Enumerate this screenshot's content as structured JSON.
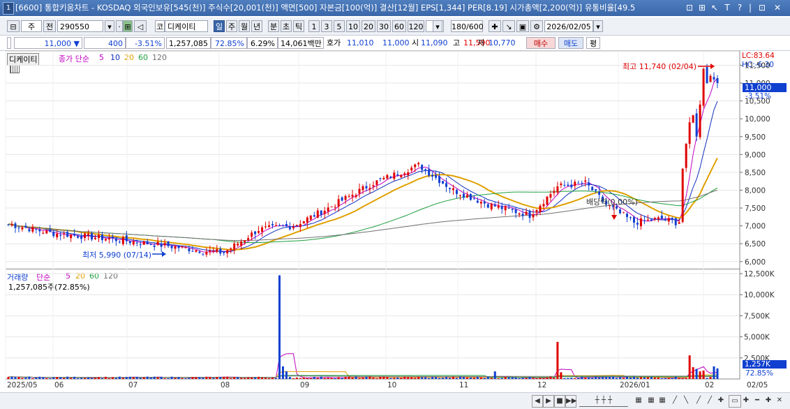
{
  "window": {
    "number": "1",
    "title": "[6600] 통합키움차트 - KOSDAQ 외국인보유[545(천)] 주식수[20,001(천)] 액면[500] 자본금[100(억)] 결산[12월] EPS[1,344] PER[8.19] 시가총액[2,200(억)] 유통비율[49.5",
    "controls": [
      "⊡",
      "⊞",
      "↖",
      "T",
      "?",
      "|",
      "⊡",
      "✕"
    ]
  },
  "toolbar": {
    "period_type": "주",
    "prev_label": "전",
    "code": "290550",
    "stock_name": "디케이티",
    "prefix": "코",
    "period_buttons": [
      "일",
      "주",
      "월",
      "년",
      "분",
      "초",
      "틱"
    ],
    "minute_buttons": [
      "1",
      "3",
      "5",
      "10",
      "20",
      "30",
      "60",
      "120"
    ],
    "count": "180/600",
    "date": "2026/02/05"
  },
  "infobar": {
    "price": "11,000",
    "direction": "▼",
    "change": "400",
    "change_pct": "-3.51%",
    "volume": "1,257,085",
    "vol_ratio": "72.85%",
    "turnover": "6.29%",
    "amount": "14,061백만",
    "hoga_label": "호가",
    "bid": "11,010",
    "ask": "11,000",
    "open_label": "시",
    "open": "11,090",
    "high_label": "고",
    "high": "11,590",
    "low_label": "저",
    "low": "10,770",
    "buy_label": "매수",
    "sell_label": "매도",
    "eval_label": "평"
  },
  "price_panel": {
    "name_tag": "디케이티",
    "legend": {
      "label": "종가 단순",
      "periods": [
        "5",
        "10",
        "20",
        "60",
        "120"
      ]
    },
    "lc": "LC:83.64",
    "hc": "HC:-6.30",
    "current_price": "11,000",
    "current_pct": "-3.51%",
    "high_annotation": "최고 11,740 (02/04)",
    "low_annotation": "최저 5,990 (07/14)",
    "dividend_annotation": "배당락(0.00%)",
    "y_ticks": [
      "11,500",
      "11,000",
      "10,500",
      "10,000",
      "9,500",
      "9,000",
      "8,500",
      "8,000",
      "7,500",
      "7,000",
      "6,500",
      "6,000"
    ]
  },
  "volume_panel": {
    "title": "거래량",
    "legend": {
      "label": "단순",
      "periods": [
        "5",
        "20",
        "60",
        "120"
      ]
    },
    "current": "1,257,085주(72.85%)",
    "current_tag": "1,257K",
    "current_pct": "72.85%",
    "y_ticks": [
      "12,500K",
      "10,000K",
      "7,500K",
      "5,000K",
      "2,500K"
    ]
  },
  "x_axis": [
    "2025/05",
    "06",
    "07",
    "08",
    "09",
    "10",
    "11",
    "12",
    "2026/01",
    "02",
    "02/05"
  ],
  "colors": {
    "up": "#e00000",
    "down": "#1040d0",
    "ma5": "#c000c0",
    "ma10": "#1030c0",
    "ma20": "#e0a000",
    "ma60": "#20a040",
    "ma120": "#707070",
    "titlebar": "#3a66a8"
  },
  "chart_data": {
    "type": "candlestick",
    "ylim": [
      5800,
      11900
    ],
    "highest": {
      "value": 11740,
      "date": "02/04"
    },
    "lowest": {
      "value": 5990,
      "date": "07/14"
    },
    "close_series": {
      "name": "종가",
      "x": [
        "2025/05",
        "06",
        "07",
        "08",
        "09",
        "10",
        "11",
        "12",
        "2026/01",
        "02",
        "02/05"
      ],
      "values": [
        7000,
        6700,
        6300,
        7200,
        8600,
        7600,
        8100,
        7200,
        6900,
        10100,
        11000
      ]
    },
    "volume_series": {
      "name": "거래량",
      "x": [
        "2025/05",
        "06",
        "07",
        "08",
        "09",
        "10",
        "11",
        "12",
        "2026/01",
        "02",
        "02/05"
      ],
      "values": [
        200,
        150,
        200,
        12300,
        400,
        300,
        4400,
        300,
        300,
        2800,
        1257
      ]
    }
  }
}
